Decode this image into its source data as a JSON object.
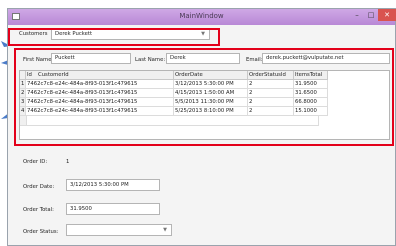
{
  "window": {
    "title": "MainWindow"
  },
  "customers": {
    "label": "Customers",
    "selected": "Derek Puckett"
  },
  "customer_detail": {
    "first_name_label": "First Name:",
    "first_name": "Puckett",
    "last_name_label": "Last Name:",
    "last_name": "Derek",
    "email_label": "Email:",
    "email": "derek.puckett@vulputate.net"
  },
  "orders_grid": {
    "columns": [
      "Id",
      "CustomerId",
      "OrderDate",
      "OrderStatusId",
      "ItemsTotal"
    ],
    "rows": [
      {
        "index": "1",
        "id": "1",
        "customer_id": "7462c7c8-e24c-484a-8f93-013f1c479615",
        "order_date": "3/12/2013 5:30:00 PM",
        "status_id": "2",
        "items_total": "31.9500"
      },
      {
        "index": "2",
        "id": "2",
        "customer_id": "7462c7c8-e24c-484a-8f93-013f1c479615",
        "order_date": "4/15/2013 1:50:00 AM",
        "status_id": "2",
        "items_total": "31.6500"
      },
      {
        "index": "3",
        "id": "3",
        "customer_id": "7462c7c8-e24c-484a-8f93-013f1c479615",
        "order_date": "5/5/2013 11:30:00 PM",
        "status_id": "2",
        "items_total": "66.8000"
      },
      {
        "index": "4",
        "id": "4",
        "customer_id": "7462c7c8-e24c-484a-8f93-013f1c479615",
        "order_date": "5/25/2013 8:10:00 PM",
        "status_id": "2",
        "items_total": "15.1000"
      }
    ]
  },
  "order_detail": {
    "order_id_label": "Order ID:",
    "order_id": "1",
    "order_date_label": "Order Date:",
    "order_date": "3/12/2013 5:30:00 PM",
    "order_total_label": "Order Total:",
    "order_total": "31.9500",
    "order_status_label": "Order Status:",
    "order_status": ""
  },
  "colors": {
    "highlight": "#e3001a",
    "arrow": "#4a7bc8",
    "titlebar": "#c79be0"
  }
}
